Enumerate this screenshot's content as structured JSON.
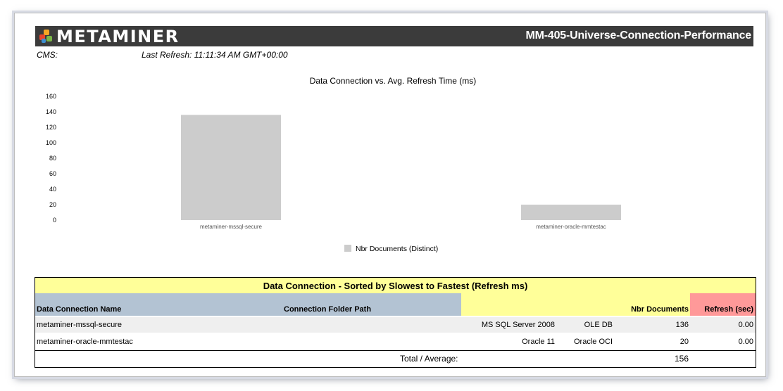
{
  "header": {
    "logo_text": "METAMINER",
    "report_title": "MM-405-Universe-Connection-Performance"
  },
  "meta": {
    "cms_label": "CMS:",
    "last_refresh": "Last Refresh: 11:11:34 AM GMT+00:00"
  },
  "chart_data": {
    "type": "bar",
    "title": "Data Connection vs. Avg. Refresh Time (ms)",
    "categories": [
      "metaminer-mssql-secure",
      "metaminer-oracle-mmtestac"
    ],
    "series": [
      {
        "name": "Nbr Documents (Distinct)",
        "values": [
          136,
          20
        ],
        "color": "#cccccc"
      }
    ],
    "ylim": [
      0,
      160
    ],
    "yticks": [
      "0",
      "20",
      "40",
      "60",
      "80",
      "100",
      "120",
      "140",
      "160"
    ],
    "grid": false,
    "legend_position": "bottom"
  },
  "table": {
    "title": "Data Connection - Sorted by Slowest to Fastest (Refresh ms)",
    "headers": {
      "name": "Data Connection Name",
      "folder": "Connection Folder Path",
      "docs": "Nbr Documents",
      "refresh": "Refresh (sec)"
    },
    "rows": [
      {
        "name": "metaminer-mssql-secure",
        "db": "MS SQL Server 2008",
        "driver": "OLE DB",
        "docs": "136",
        "refresh": "0.00"
      },
      {
        "name": "metaminer-oracle-mmtestac",
        "db": "Oracle 11",
        "driver": "Oracle OCI",
        "docs": "20",
        "refresh": "0.00"
      }
    ],
    "total_label": "Total / Average:",
    "total_docs": "156"
  }
}
